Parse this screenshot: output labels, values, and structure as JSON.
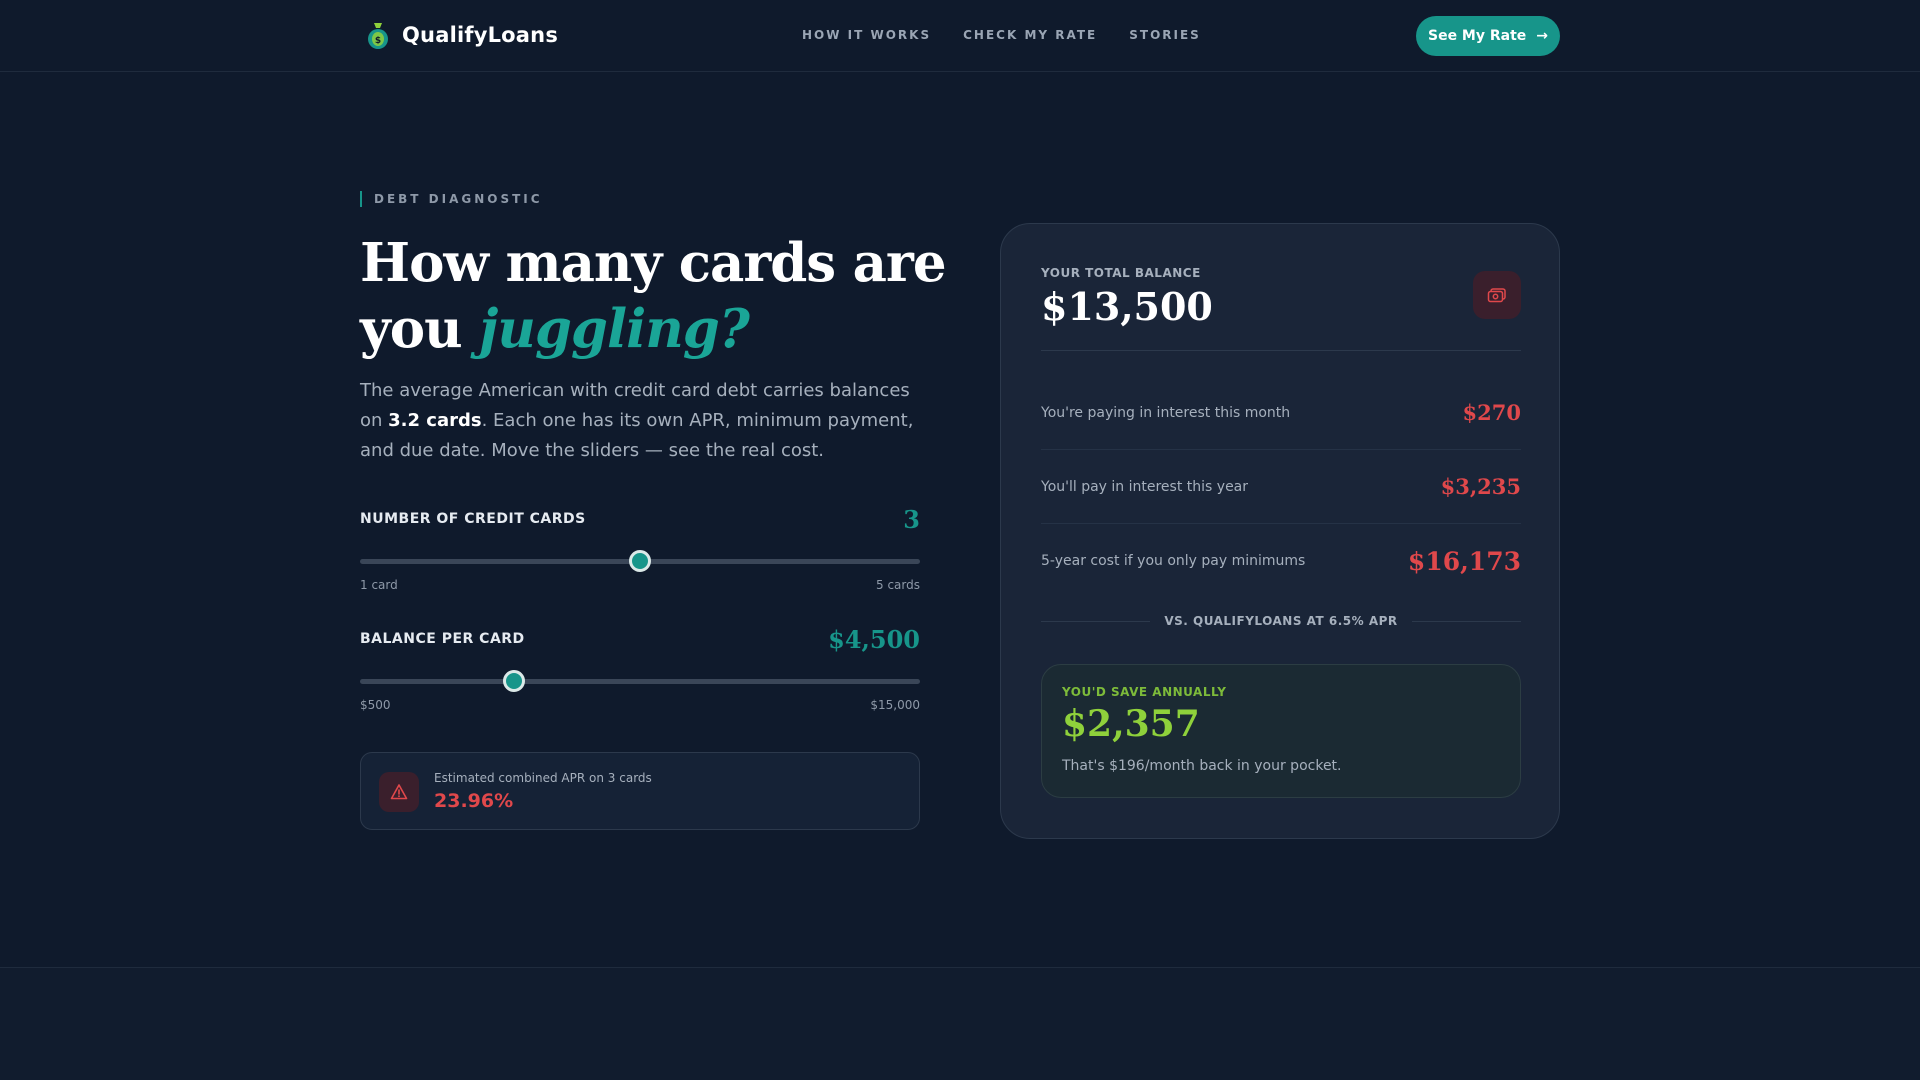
{
  "nav": {
    "brand": "QualifyLoans",
    "links": [
      "HOW IT WORKS",
      "CHECK MY RATE",
      "STORIES"
    ],
    "cta_label": "See My Rate",
    "cta_arrow": "→"
  },
  "hero": {
    "eyebrow": "DEBT DIAGNOSTIC",
    "headline_line1": "How many cards are",
    "headline_line2_plain": "you ",
    "headline_line2_accent": "juggling?",
    "lead_part1": "The average American with credit card debt carries balances on ",
    "lead_bold": "3.2 cards",
    "lead_part2": ". Each one has its own APR, minimum payment, and due date. Move the sliders — see the real cost."
  },
  "sliders": {
    "cards": {
      "label": "NUMBER OF CREDIT CARDS",
      "value": "3",
      "min_label": "1 card",
      "max_label": "5 cards",
      "min": 1,
      "max": 5,
      "current": 3
    },
    "balance": {
      "label": "BALANCE PER CARD",
      "value": "$4,500",
      "min_label": "$500",
      "max_label": "$15,000",
      "min": 500,
      "max": 15000,
      "current": 4500
    }
  },
  "apr": {
    "caption": "Estimated combined APR on 3 cards",
    "value": "23.96%",
    "icon": "warning-icon"
  },
  "summary": {
    "total_caption": "YOUR TOTAL BALANCE",
    "total_value": "$13,500",
    "icon": "cash-icon",
    "rows": [
      {
        "label": "You're paying in interest this month",
        "value": "$270"
      },
      {
        "label": "You'll pay in interest this year",
        "value": "$3,235"
      },
      {
        "label": "5-year cost if you only pay minimums",
        "value": "$16,173"
      }
    ],
    "vs_label": "VS. QUALIFYLOANS AT 6.5% APR",
    "save_caption": "YOU'D SAVE ANNUALLY",
    "save_value": "$2,357",
    "save_sub": "That's $196/month back in your pocket."
  },
  "colors": {
    "accent": "#17958a",
    "danger": "#e0484b",
    "positive": "#8fd13b",
    "background": "#0f1a2c"
  }
}
